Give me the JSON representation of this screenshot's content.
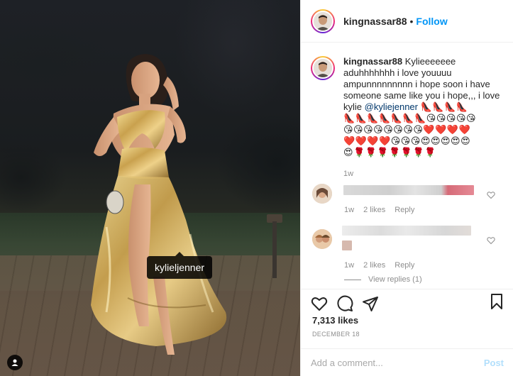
{
  "post": {
    "photo_tag_label": "kylieljenner",
    "tag_icon": "person-icon"
  },
  "header": {
    "username": "kingnassar88",
    "separator": "•",
    "follow_label": "Follow"
  },
  "caption": {
    "username": "kingnassar88",
    "text_part1": "Kylieeeeeee aduhhhhhhh i love youuuu ampunnnnnnnnn i hope soon i have someone same like you i hope,,, i love kylie",
    "mention": "@kyliejenner",
    "emoji_line1": "👠👠👠👠",
    "emoji_line2": "👠👠👠👠👠👠👠😘😘😘😘😘",
    "emoji_line3": "😘😘😘😘😘😘😘😘❤️❤️❤️❤️",
    "emoji_line4": "❤️❤️❤️❤️😘😘😘😍😍😍😍😍",
    "emoji_line5": "😍🌹🌹🌹🌹🌹🌹🌹",
    "time": "1w"
  },
  "comments": [
    {
      "time": "1w",
      "likes": "2 likes",
      "reply": "Reply"
    },
    {
      "time": "1w",
      "likes": "2 likes",
      "reply": "Reply"
    }
  ],
  "view_replies": "View replies (1)",
  "likes_count": "7,313 likes",
  "date": "DECEMBER 18",
  "add_comment_placeholder": "Add a comment...",
  "post_label": "Post",
  "colors": {
    "follow": "#0095f6",
    "post_disabled": "#b2dffc",
    "mention": "#00376b"
  }
}
